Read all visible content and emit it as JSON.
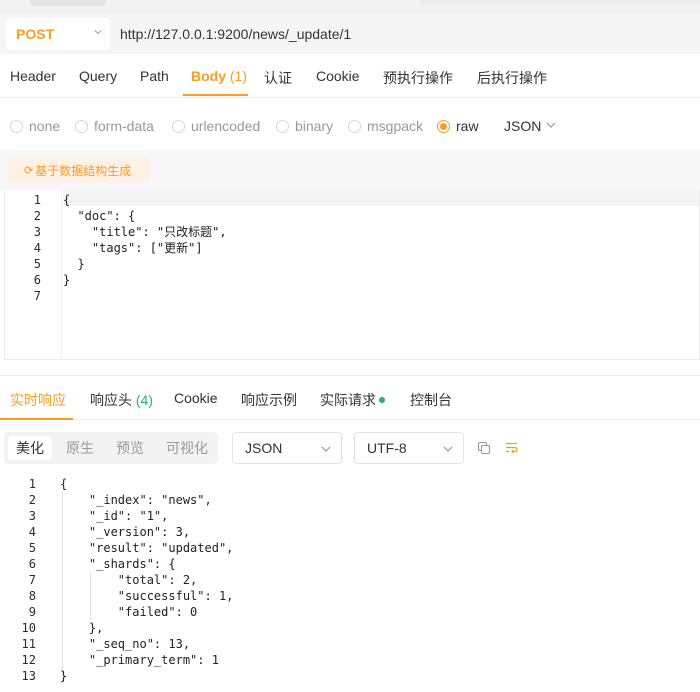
{
  "request": {
    "method": "POST",
    "url": "http://127.0.0.1:9200/news/_update/1"
  },
  "req_tabs": [
    {
      "label": "Header"
    },
    {
      "label": "Query"
    },
    {
      "label": "Path"
    },
    {
      "label": "Body",
      "count": "(1)",
      "active": true
    },
    {
      "label": "认证"
    },
    {
      "label": "Cookie"
    },
    {
      "label": "预执行操作"
    },
    {
      "label": "后执行操作"
    }
  ],
  "body_types": [
    {
      "label": "none"
    },
    {
      "label": "form-data"
    },
    {
      "label": "urlencoded"
    },
    {
      "label": "binary"
    },
    {
      "label": "msgpack"
    },
    {
      "label": "raw",
      "checked": true
    }
  ],
  "body_format": "JSON",
  "generate_button": "基于数据结构生成",
  "request_body_lines": [
    {
      "n": "1",
      "text": "{"
    },
    {
      "n": "2",
      "text": "  \"doc\": {"
    },
    {
      "n": "3",
      "text": "    \"title\": \"只改标题\","
    },
    {
      "n": "4",
      "text": "    \"tags\": [\"更新\"]"
    },
    {
      "n": "5",
      "text": "  }"
    },
    {
      "n": "6",
      "text": "}"
    },
    {
      "n": "7",
      "text": ""
    }
  ],
  "resp_tabs": [
    {
      "label": "实时响应",
      "active": true
    },
    {
      "label": "响应头",
      "count": "(4)"
    },
    {
      "label": "Cookie"
    },
    {
      "label": "响应示例"
    },
    {
      "label": "实际请求"
    },
    {
      "label": "控制台"
    }
  ],
  "view_modes": [
    {
      "label": "美化",
      "active": true
    },
    {
      "label": "原生"
    },
    {
      "label": "预览"
    },
    {
      "label": "可视化"
    }
  ],
  "resp_format": "JSON",
  "resp_encoding": "UTF-8",
  "response_lines": [
    {
      "n": "1",
      "text": "{"
    },
    {
      "n": "2",
      "text": "    \"_index\": \"news\","
    },
    {
      "n": "3",
      "text": "    \"_id\": \"1\","
    },
    {
      "n": "4",
      "text": "    \"_version\": 3,"
    },
    {
      "n": "5",
      "text": "    \"result\": \"updated\","
    },
    {
      "n": "6",
      "text": "    \"_shards\": {"
    },
    {
      "n": "7",
      "text": "        \"total\": 2,"
    },
    {
      "n": "8",
      "text": "        \"successful\": 1,"
    },
    {
      "n": "9",
      "text": "        \"failed\": 0"
    },
    {
      "n": "10",
      "text": "    },"
    },
    {
      "n": "11",
      "text": "    \"_seq_no\": 13,"
    },
    {
      "n": "12",
      "text": "    \"_primary_term\": 1"
    },
    {
      "n": "13",
      "text": "}"
    }
  ],
  "colors": {
    "accent": "#ff9a1f",
    "status_green": "#22b573"
  }
}
